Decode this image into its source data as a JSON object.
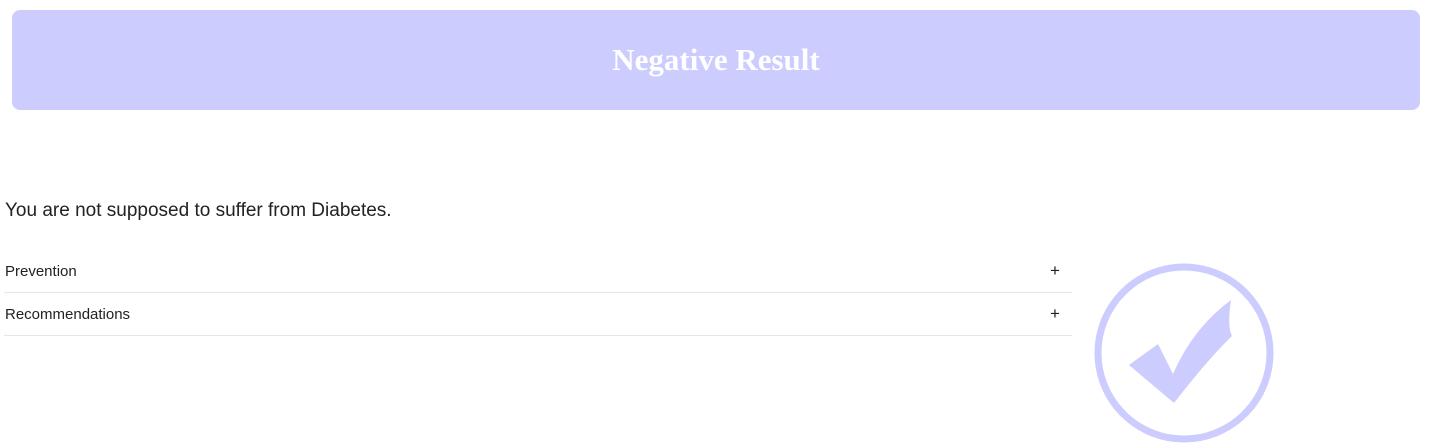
{
  "banner": {
    "title": "Negative Result"
  },
  "result": {
    "message": "You are not supposed to suffer from Diabetes."
  },
  "accordion": {
    "items": [
      {
        "label": "Prevention",
        "toggle": "+"
      },
      {
        "label": "Recommendations",
        "toggle": "+"
      }
    ]
  },
  "icon": {
    "name": "checkmark-circle-icon",
    "color": "#ccccff"
  },
  "colors": {
    "banner_bg": "#ccccff",
    "banner_text": "#ffffff",
    "divider": "#e6e6e6"
  }
}
